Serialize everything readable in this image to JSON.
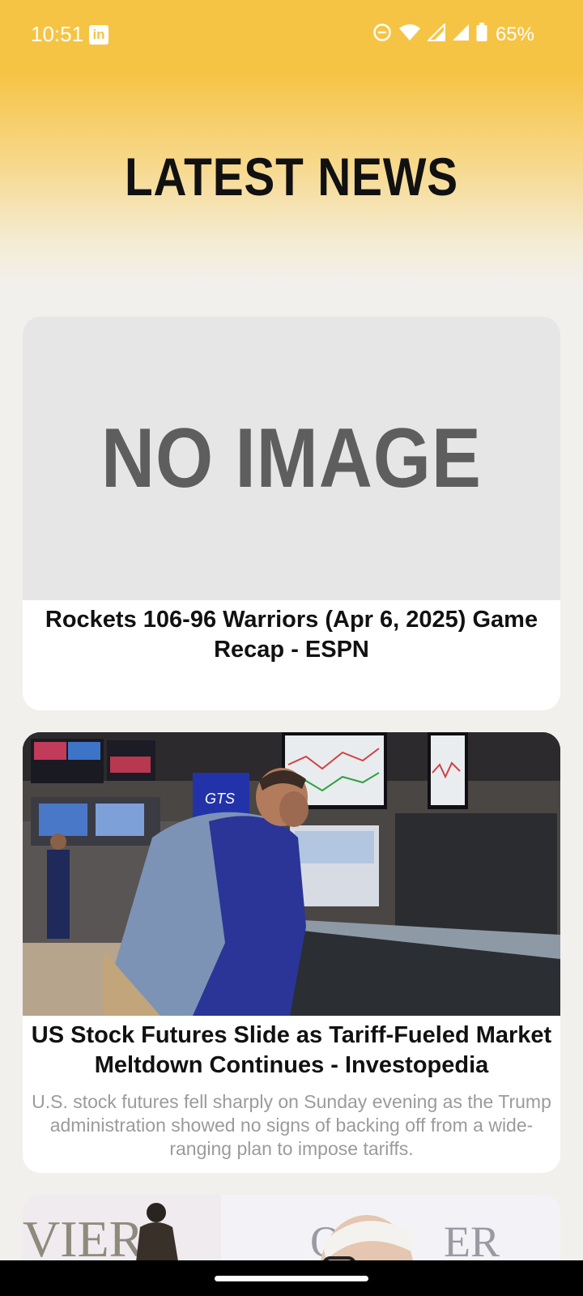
{
  "status_bar": {
    "time": "10:51",
    "battery": "65%",
    "notification_icon": "linkedin-icon",
    "icons": [
      "do-not-disturb-icon",
      "wifi-icon",
      "signal-icon",
      "signal-icon",
      "battery-icon"
    ]
  },
  "header": {
    "title": "LATEST NEWS"
  },
  "articles": [
    {
      "image_placeholder": "NO IMAGE",
      "title": "Rockets 106-96 Warriors (Apr 6, 2025) Game Recap - ESPN",
      "description": ""
    },
    {
      "image_alt": "trader-on-stock-exchange-floor",
      "title": "US Stock Futures Slide as Tariff-Fueled Market Meltdown Continues - Investopedia",
      "description": "U.S. stock futures fell sharply on Sunday evening as the Trump administration showed no signs of backing off from a wide-ranging plan to impose tariffs."
    },
    {
      "image_alt": "man-with-award-statue",
      "title": "",
      "description": ""
    }
  ],
  "colors": {
    "header_yellow": "#f6c445",
    "background": "#f1f0ed",
    "card": "#ffffff",
    "title_text": "#111111",
    "desc_text": "#9b9b9b",
    "placeholder_bg": "#e6e6e6",
    "placeholder_text": "#5e5e5e"
  }
}
